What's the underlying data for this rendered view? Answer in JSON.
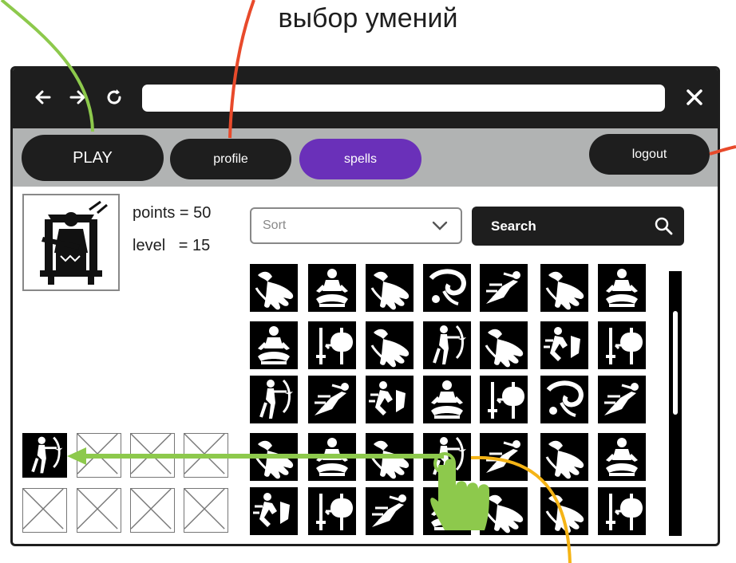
{
  "annotation_title": "выбор умений",
  "nav": {
    "play_label": "PLAY",
    "profile_label": "profile",
    "spells_label": "spells",
    "logout_label": "logout"
  },
  "browser": {
    "back_icon": "arrow-left-icon",
    "forward_icon": "arrow-right-icon",
    "reload_icon": "reload-icon",
    "close_icon": "close-icon",
    "url": ""
  },
  "player": {
    "points_label": "points = 50",
    "level_label": "level   = 15"
  },
  "controls": {
    "sort_placeholder": "Sort",
    "search_label": "Search"
  },
  "spell_grid": [
    [
      "hand-icon",
      "meditate-icon",
      "hand-icon",
      "vortex-icon",
      "dash-icon",
      "hand-icon",
      "meditate-icon"
    ],
    [
      "meditate-icon",
      "sword-axe-icon",
      "hand-icon",
      "archer-icon",
      "hand-icon",
      "runner-shield-icon",
      "sword-axe-icon"
    ],
    [
      "archer-icon",
      "dash-icon",
      "runner-shield-icon",
      "meditate-icon",
      "sword-axe-icon",
      "vortex-icon",
      "dash-icon"
    ],
    [
      "hand-icon",
      "meditate-icon",
      "hand-icon",
      "archer-icon",
      "dash-icon",
      "hand-icon",
      "meditate-icon"
    ],
    [
      "runner-shield-icon",
      "sword-axe-icon",
      "dash-icon",
      "meditate-icon",
      "hand-icon",
      "hand-icon",
      "sword-axe-icon"
    ]
  ],
  "equipped_slots": [
    "archer-icon",
    "empty",
    "empty",
    "empty",
    "empty",
    "empty",
    "empty",
    "empty"
  ],
  "colors": {
    "dark": "#1e1e1e",
    "accent": "#6a30b9",
    "navbar_bg": "#b1b3b3",
    "annotation_green": "#8dc94c",
    "annotation_red": "#e84a2b",
    "annotation_orange": "#f5b416"
  }
}
